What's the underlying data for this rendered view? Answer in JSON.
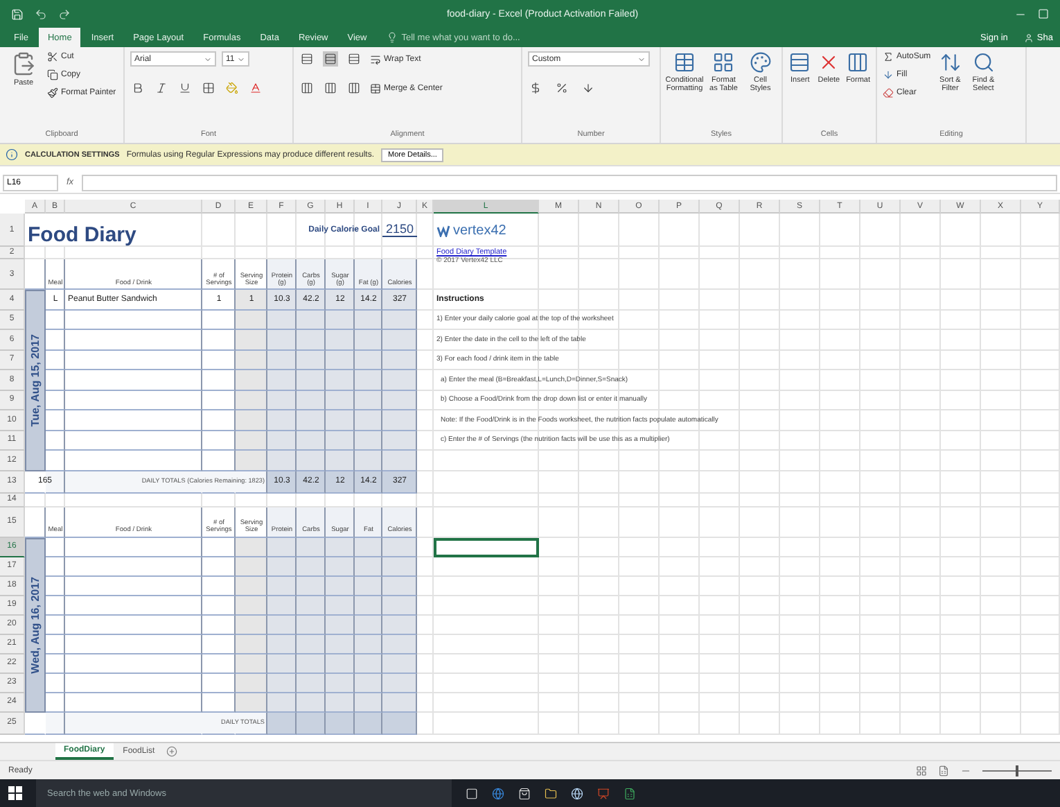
{
  "window": {
    "title": "food-diary - Excel (Product Activation Failed)"
  },
  "menu_tabs": [
    {
      "label": "File",
      "selected": false
    },
    {
      "label": "Home",
      "selected": true
    },
    {
      "label": "Insert",
      "selected": false
    },
    {
      "label": "Page Layout",
      "selected": false
    },
    {
      "label": "Formulas",
      "selected": false
    },
    {
      "label": "Data",
      "selected": false
    },
    {
      "label": "Review",
      "selected": false
    },
    {
      "label": "View",
      "selected": false
    }
  ],
  "tell_me": {
    "placeholder": "Tell me what you want to do..."
  },
  "account": {
    "sign_in": "Sign in",
    "share": "Sha"
  },
  "ribbon": {
    "clipboard": {
      "label": "Clipboard",
      "paste": "Paste",
      "cut": "Cut",
      "copy": "Copy",
      "painter": "Format Painter"
    },
    "font": {
      "label": "Font",
      "name": "Arial",
      "size": "11"
    },
    "alignment": {
      "label": "Alignment",
      "wrap": "Wrap Text",
      "merge": "Merge & Center"
    },
    "number": {
      "label": "Number",
      "format": "Custom"
    },
    "styles": {
      "label": "Styles",
      "buttons": [
        "Conditional Formatting",
        "Format as Table",
        "Cell Styles"
      ]
    },
    "cells": {
      "label": "Cells",
      "buttons": [
        "Insert",
        "Delete",
        "Format"
      ]
    },
    "editing": {
      "label": "Editing",
      "autosum": "AutoSum",
      "fill": "Fill",
      "clear": "Clear",
      "sort": "Sort & Filter",
      "find": "Find & Select"
    }
  },
  "info_bar": {
    "title": "CALCULATION SETTINGS",
    "message": "Formulas using Regular Expressions may produce different results.",
    "button": "More Details..."
  },
  "formula_bar": {
    "name_box": "L16",
    "fx": "fx"
  },
  "columns": [
    {
      "label": "A",
      "selected": false
    },
    {
      "label": "B",
      "selected": false
    },
    {
      "label": "C",
      "selected": false
    },
    {
      "label": "D",
      "selected": false
    },
    {
      "label": "E",
      "selected": false
    },
    {
      "label": "F",
      "selected": false
    },
    {
      "label": "G",
      "selected": false
    },
    {
      "label": "H",
      "selected": false
    },
    {
      "label": "I",
      "selected": false
    },
    {
      "label": "J",
      "selected": false
    },
    {
      "label": "K",
      "selected": false
    },
    {
      "label": "L",
      "selected": true
    },
    {
      "label": "M",
      "selected": false
    },
    {
      "label": "N",
      "selected": false
    },
    {
      "label": "O",
      "selected": false
    },
    {
      "label": "P",
      "selected": false
    },
    {
      "label": "Q",
      "selected": false
    },
    {
      "label": "R",
      "selected": false
    },
    {
      "label": "S",
      "selected": false
    },
    {
      "label": "T",
      "selected": false
    },
    {
      "label": "U",
      "selected": false
    },
    {
      "label": "V",
      "selected": false
    },
    {
      "label": "W",
      "selected": false
    },
    {
      "label": "X",
      "selected": false
    },
    {
      "label": "Y",
      "selected": false
    }
  ],
  "rows": [
    {
      "label": "1",
      "selected": false
    },
    {
      "label": "2",
      "selected": false
    },
    {
      "label": "3",
      "selected": false
    },
    {
      "label": "4",
      "selected": false
    },
    {
      "label": "5",
      "selected": false
    },
    {
      "label": "6",
      "selected": false
    },
    {
      "label": "7",
      "selected": false
    },
    {
      "label": "8",
      "selected": false
    },
    {
      "label": "9",
      "selected": false
    },
    {
      "label": "10",
      "selected": false
    },
    {
      "label": "11",
      "selected": false
    },
    {
      "label": "12",
      "selected": false
    },
    {
      "label": "13",
      "selected": false
    },
    {
      "label": "14",
      "selected": false
    },
    {
      "label": "15",
      "selected": false
    },
    {
      "label": "16",
      "selected": true
    },
    {
      "label": "17",
      "selected": false
    },
    {
      "label": "18",
      "selected": false
    },
    {
      "label": "19",
      "selected": false
    },
    {
      "label": "20",
      "selected": false
    },
    {
      "label": "21",
      "selected": false
    },
    {
      "label": "22",
      "selected": false
    },
    {
      "label": "23",
      "selected": false
    },
    {
      "label": "24",
      "selected": false
    },
    {
      "label": "25",
      "selected": false
    }
  ],
  "zoom": {
    "level": 0.5
  },
  "sheet": {
    "title": "Food Diary",
    "goal_label": "Daily Calorie Goal",
    "goal": "2150",
    "days": [
      {
        "date": "Tue, Aug 15, 2017",
        "headers": [
          "Meal",
          "Food / Drink",
          "# of Servings",
          "Serving Size",
          "Protein (g)",
          "Carbs (g)",
          "Sugar (g)",
          "Fat (g)",
          "Calories"
        ],
        "entries": [
          {
            "meal": "L",
            "food": "Peanut Butter Sandwich",
            "servings": "1",
            "size": "1",
            "protein": "10.3",
            "carbs": "42.2",
            "sugar": "12",
            "fat": "14.2",
            "calories": "327"
          }
        ],
        "totals": {
          "count": "165",
          "label": "DAILY TOTALS (Calories Remaining: 1823)",
          "values": [
            "10.3",
            "42.2",
            "12",
            "14.2",
            "327"
          ]
        }
      },
      {
        "date": "Wed, Aug 16, 2017",
        "headers": [
          "Meal",
          "Food / Drink",
          "# of Servings",
          "Serving Size",
          "Protein",
          "Carbs",
          "Sugar",
          "Fat",
          "Calories"
        ],
        "totals": {
          "label": "DAILY TOTALS"
        }
      }
    ]
  },
  "side": {
    "logo": "vertex42",
    "link": "Food Diary Template",
    "copyright": "© 2017 Vertex42 LLC",
    "heading": "Instructions",
    "lines": [
      "1) Enter your daily calorie goal at the top of the worksheet",
      "2) Enter the date in the cell to the left of the table",
      "3) For each food / drink item in the table",
      "a) Enter the meal (B=Breakfast,L=Lunch,D=Dinner,S=Snack)",
      "b) Choose a Food/Drink from the drop down list or enter it manually",
      "Note: If the Food/Drink is in the Foods worksheet, the nutrition facts populate automatically",
      "c) Enter the # of Servings (the nutrition facts will be use this as a multiplier)"
    ]
  },
  "sheet_tabs": [
    {
      "label": "FoodDiary",
      "selected": true
    },
    {
      "label": "FoodList",
      "selected": false
    }
  ],
  "status": {
    "text": "Ready"
  },
  "taskbar": {
    "search": {
      "placeholder": "Search the web and Windows"
    }
  }
}
